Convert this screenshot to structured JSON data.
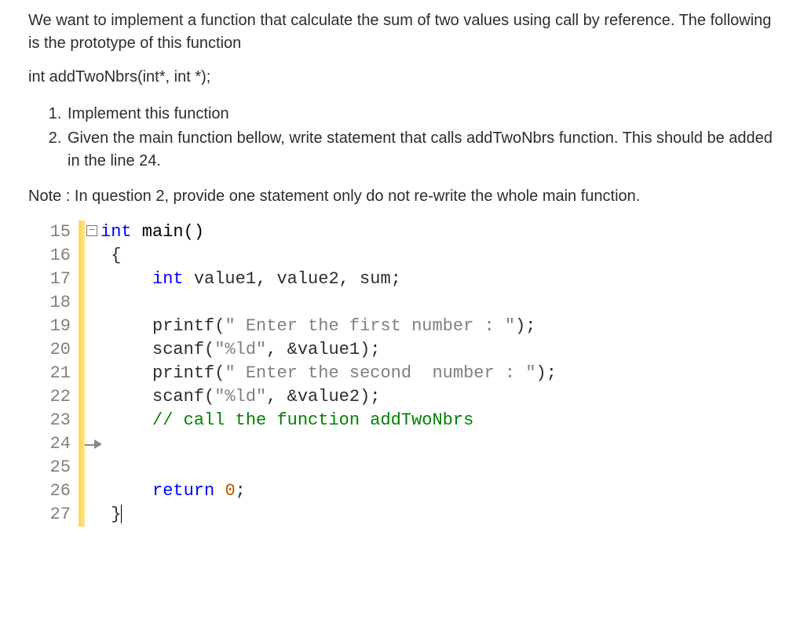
{
  "intro1": "We want to implement a function that calculate the sum of two values using call by reference. The following is the prototype of this function",
  "prototype": "int addTwoNbrs(int*, int *);",
  "tasks": [
    "Implement this function",
    "Given the main function bellow, write statement that calls addTwoNbrs function.  This should be added in the line 24."
  ],
  "note": "Note : In question 2, provide one statement only  do not re-write the whole main function.",
  "code": {
    "lines": [
      "15",
      "16",
      "17",
      "18",
      "19",
      "20",
      "21",
      "22",
      "23",
      "24",
      "25",
      "26",
      "27"
    ],
    "l15_kw": "int",
    "l15_fn": " main()",
    "l16": "{",
    "l17_kw": "int",
    "l17_rest": " value1, value2, sum;",
    "l19_a": "printf(",
    "l19_s": "\" Enter the first number : \"",
    "l19_b": ");",
    "l20_a": "scanf(",
    "l20_s": "\"%ld\"",
    "l20_b": ", &value1);",
    "l21_a": "printf(",
    "l21_s": "\" Enter the second  number : \"",
    "l21_b": ");",
    "l22_a": "scanf(",
    "l22_s": "\"%ld\"",
    "l22_b": ", &value2);",
    "l23_c": "// call the function addTwoNbrs",
    "l26_kw": "return",
    "l26_sp": " ",
    "l26_n": "0",
    "l26_e": ";",
    "l27": "}"
  }
}
